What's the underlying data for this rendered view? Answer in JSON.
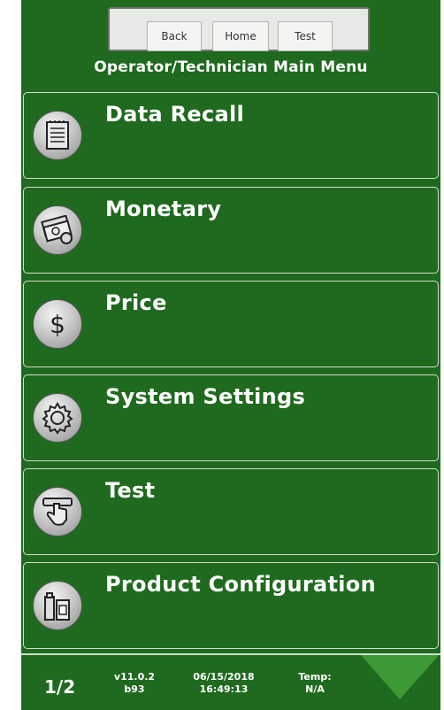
{
  "nav": {
    "back_label": "Back",
    "home_label": "Home",
    "test_label": "Test"
  },
  "page_title": "Operator/Technician Main Menu",
  "menu": {
    "items": [
      {
        "label": "Data Recall",
        "icon": "document-icon"
      },
      {
        "label": "Monetary",
        "icon": "money-icon"
      },
      {
        "label": "Price",
        "icon": "dollar-icon"
      },
      {
        "label": "System Settings",
        "icon": "gear-icon"
      },
      {
        "label": "Test",
        "icon": "hand-press-icon"
      },
      {
        "label": "Product Configuration",
        "icon": "product-icon"
      }
    ]
  },
  "footer": {
    "page_indicator": "1/2",
    "version": "v11.0.2",
    "build": "b93",
    "date": "06/15/2018",
    "time": "16:49:13",
    "temp_label": "Temp:",
    "temp_value": "N/A"
  },
  "colors": {
    "background": "#1f6a1e",
    "border": "#cfe0cc",
    "next_arrow": "#3c9a35"
  }
}
